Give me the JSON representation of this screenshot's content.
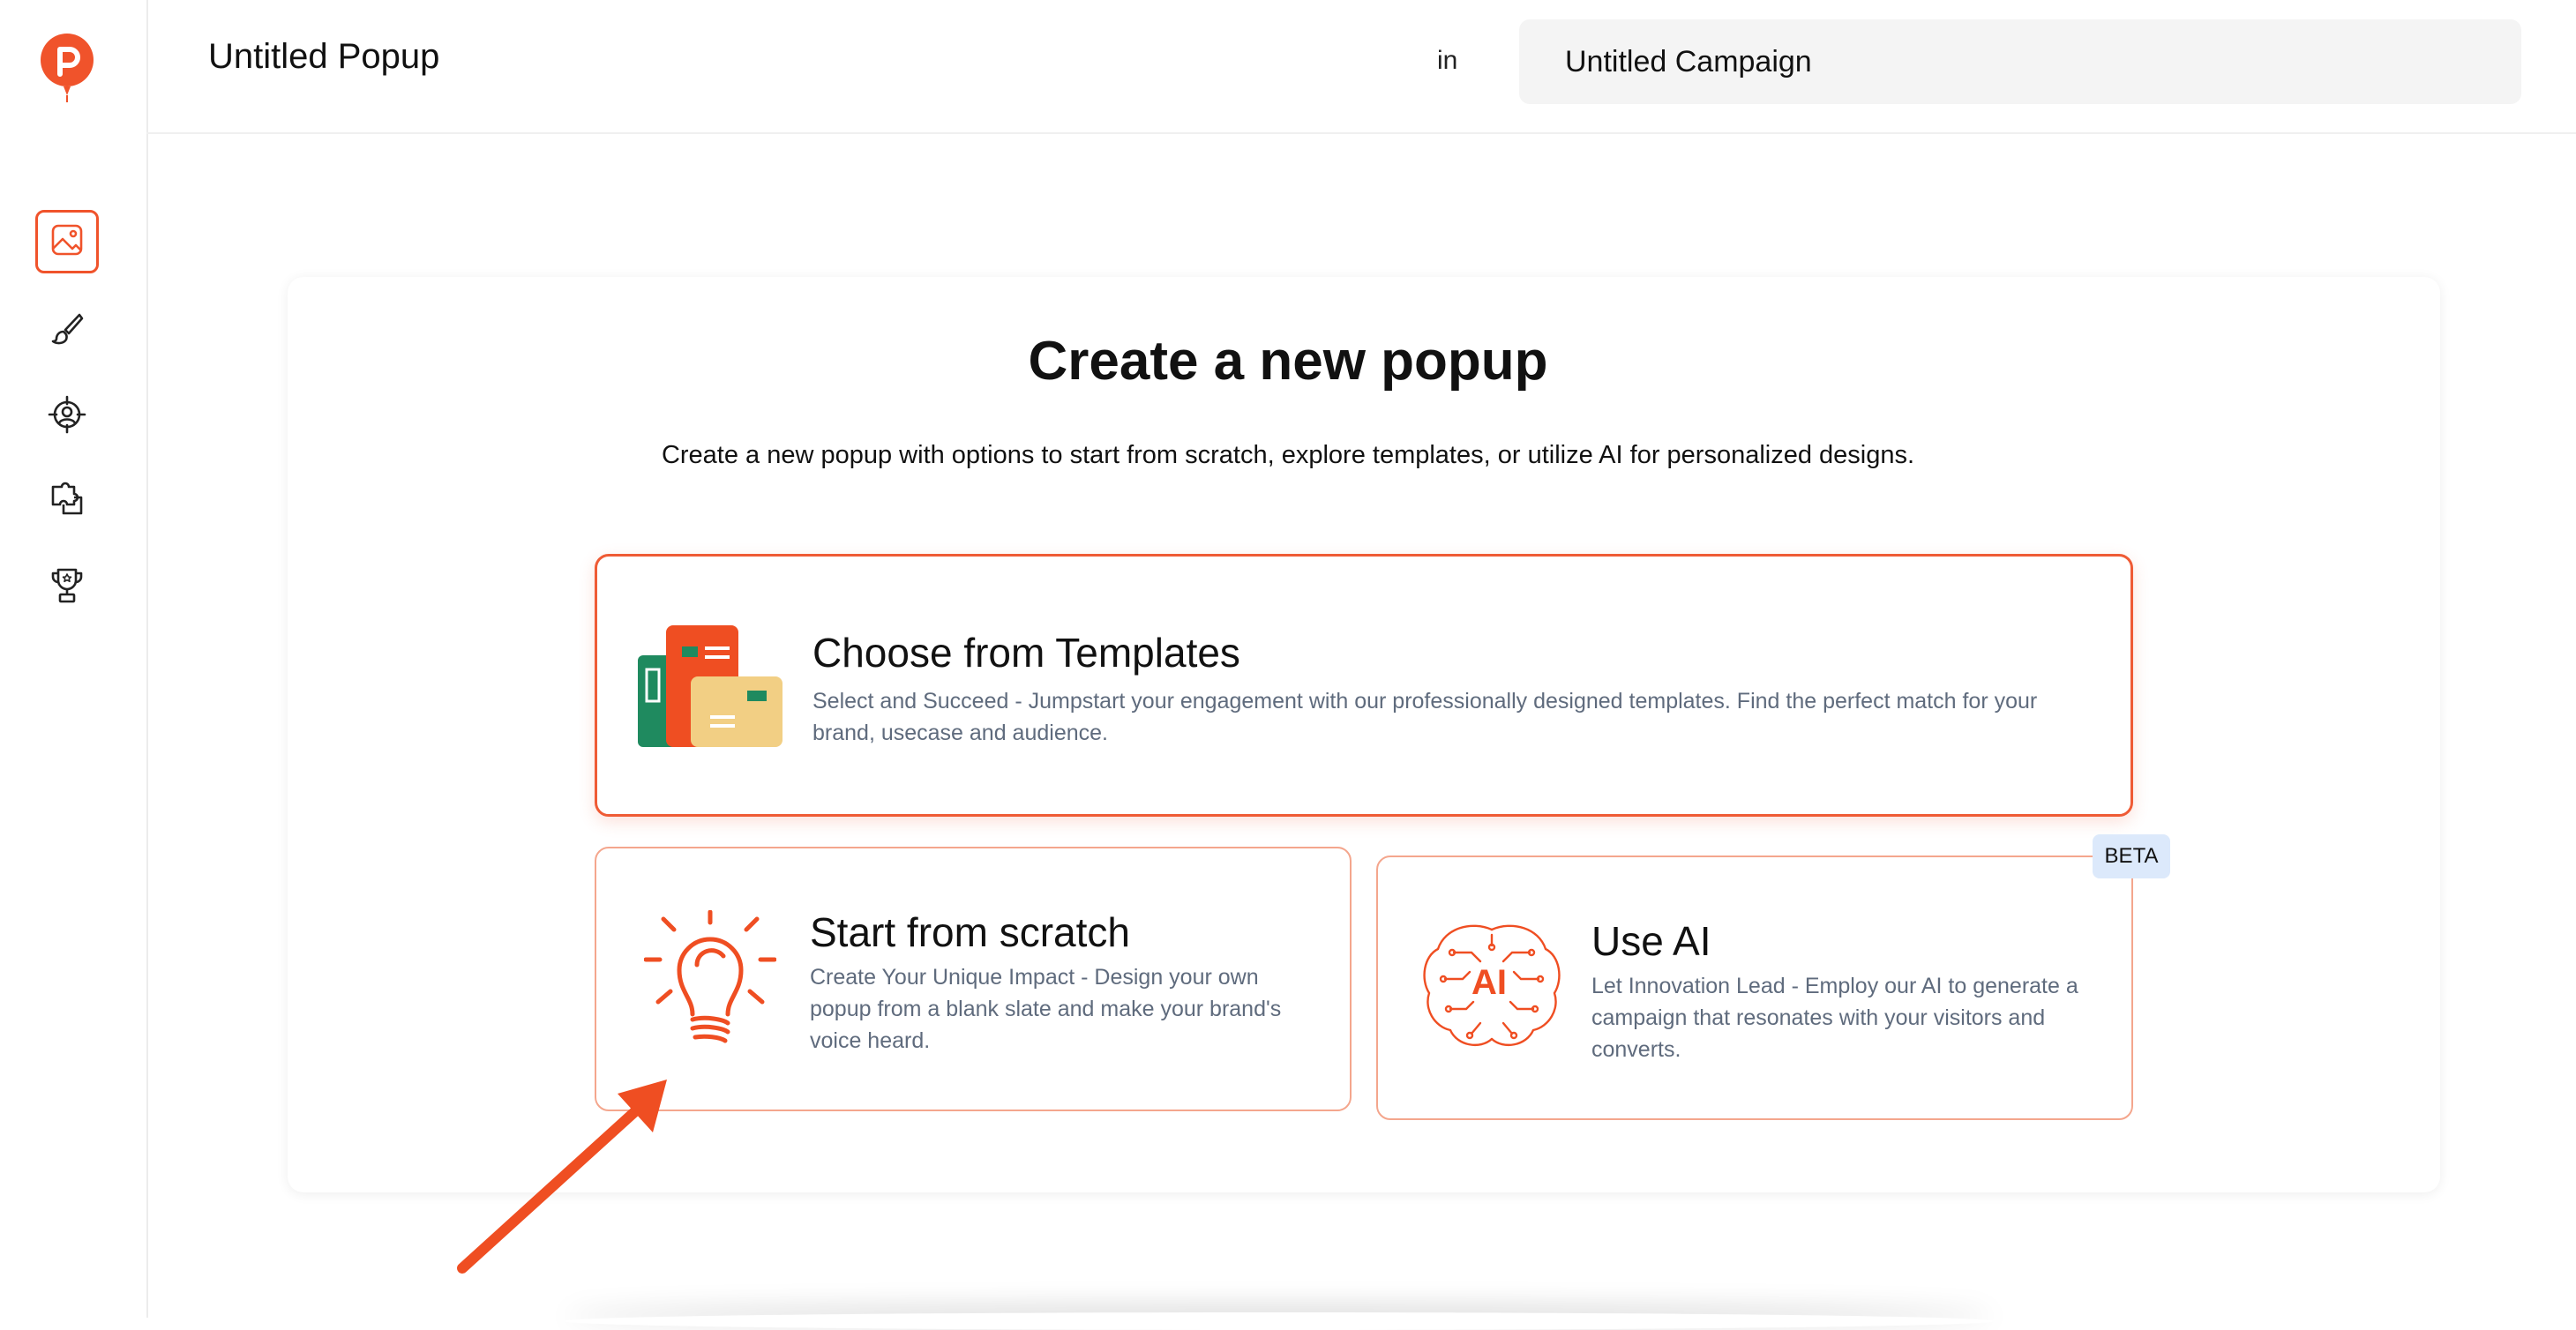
{
  "header": {
    "popup_title": "Untitled Popup",
    "in_label": "in",
    "campaign_name": "Untitled Campaign"
  },
  "sidebar": {
    "items": [
      {
        "icon": "image-icon",
        "active": true
      },
      {
        "icon": "paintbrush-icon",
        "active": false
      },
      {
        "icon": "target-user-icon",
        "active": false
      },
      {
        "icon": "puzzle-icon",
        "active": false
      },
      {
        "icon": "trophy-icon",
        "active": false
      }
    ]
  },
  "main": {
    "title": "Create a new popup",
    "subtitle": "Create a new popup with options to start from scratch, explore templates, or utilize AI for personalized designs.",
    "options": {
      "templates": {
        "title": "Choose from Templates",
        "description_line1": "Select and Succeed - Jumpstart your engagement with our professionally designed templates. Find the perfect match for your",
        "description_line2": "brand, usecase and audience."
      },
      "scratch": {
        "title": "Start from scratch",
        "description_line1": "Create Your Unique Impact - Design your own",
        "description_line2": "popup from a blank slate and make your brand's",
        "description_line3": "voice heard."
      },
      "ai": {
        "title": "Use AI",
        "badge": "BETA",
        "icon_text": "AI",
        "description_line1": "Let Innovation Lead - Employ our AI to generate a",
        "description_line2": "campaign that resonates with your visitors and",
        "description_line3": "converts."
      }
    }
  },
  "colors": {
    "accent": "#f0532b",
    "border_light": "#f4a68d",
    "description_text": "#5f6b7d",
    "beta_bg": "#dce9fb"
  }
}
